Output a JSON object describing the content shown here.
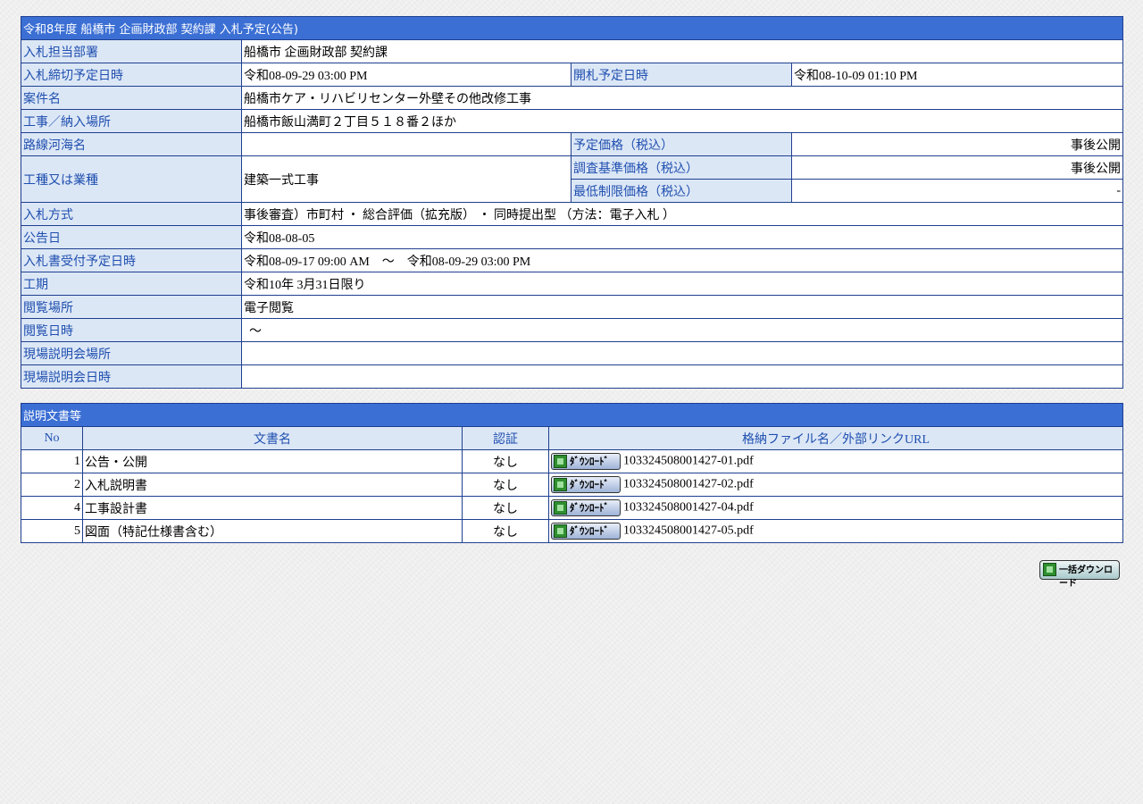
{
  "header": {
    "title": "令和8年度 船橋市 企画財政部 契約課 入札予定(公告)"
  },
  "info": {
    "department_label": "入札担当部署",
    "department_value": "船橋市 企画財政部 契約課",
    "deadline_label": "入札締切予定日時",
    "deadline_value": "令和08-09-29 03:00 PM",
    "opening_label": "開札予定日時",
    "opening_value": "令和08-10-09 01:10 PM",
    "case_label": "案件名",
    "case_value": "船橋市ケア・リハビリセンター外壁その他改修工事",
    "location_label": "工事／納入場所",
    "location_value": "船橋市飯山満町２丁目５１８番２ほか",
    "route_label": "路線河海名",
    "route_value": "",
    "planned_price_label": "予定価格（税込）",
    "planned_price_value": "事後公開",
    "type_label": "工種又は業種",
    "type_value": "建築一式工事",
    "survey_price_label": "調査基準価格（税込）",
    "survey_price_value": "事後公開",
    "min_price_label": "最低制限価格（税込）",
    "min_price_value": "-",
    "method_label": "入札方式",
    "method_value": "事後審査）市町村 ・ 総合評価（拡充版） ・ 同時提出型 （方法：電子入札 ）",
    "notice_date_label": "公告日",
    "notice_date_value": "令和08-08-05",
    "receipt_label": "入札書受付予定日時",
    "receipt_value": "令和08-09-17 09:00 AM　～　令和08-09-29 03:00 PM",
    "period_label": "工期",
    "period_value": "令和10年 3月31日限り",
    "viewing_place_label": "閲覧場所",
    "viewing_place_value": "電子閲覧",
    "viewing_date_label": "閲覧日時",
    "viewing_date_value": "～",
    "briefing_place_label": "現場説明会場所",
    "briefing_place_value": "",
    "briefing_date_label": "現場説明会日時",
    "briefing_date_value": ""
  },
  "documents": {
    "title": "説明文書等",
    "columns": [
      "No",
      "文書名",
      "認証",
      "格納ファイル名／外部リンクURL"
    ],
    "download_label": "ﾀﾞｳﾝﾛｰﾄﾞ",
    "rows": [
      {
        "no": "1",
        "name": "公告・公開",
        "auth": "なし",
        "file": "103324508001427-01.pdf"
      },
      {
        "no": "2",
        "name": "入札説明書",
        "auth": "なし",
        "file": "103324508001427-02.pdf"
      },
      {
        "no": "4",
        "name": "工事設計書",
        "auth": "なし",
        "file": "103324508001427-04.pdf"
      },
      {
        "no": "5",
        "name": "図面（特記仕様書含む）",
        "auth": "なし",
        "file": "103324508001427-05.pdf"
      }
    ]
  },
  "bulk_download": {
    "label": "一括ダウンロード"
  }
}
